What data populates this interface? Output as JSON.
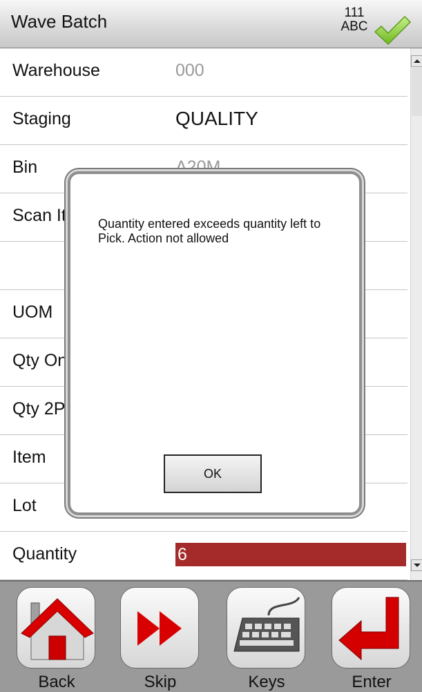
{
  "header": {
    "title": "Wave Batch",
    "mode_top": "111",
    "mode_bottom": "ABC"
  },
  "fields": [
    {
      "label": "Warehouse",
      "value": "000"
    },
    {
      "label": "Staging",
      "value": "QUALITY"
    },
    {
      "label": "Bin",
      "value": "A20M"
    },
    {
      "label": "Scan It",
      "value": ""
    },
    {
      "label": "",
      "value": ""
    },
    {
      "label": "UOM",
      "value": ""
    },
    {
      "label": "Qty On",
      "value": ""
    },
    {
      "label": "Qty 2P",
      "value": ""
    },
    {
      "label": "Item",
      "value": ""
    },
    {
      "label": "Lot",
      "value": ""
    },
    {
      "label": "Quantity",
      "value": "6"
    }
  ],
  "dialog": {
    "message": "Quantity entered exceeds quantity left to Pick. Action not allowed",
    "ok_label": "OK"
  },
  "toolbar": {
    "back": "Back",
    "skip": "Skip",
    "keys": "Keys",
    "enter": "Enter"
  },
  "colors": {
    "error_input": "#a52a2a",
    "check": "#8bd13a",
    "arrow_red": "#d40000"
  }
}
